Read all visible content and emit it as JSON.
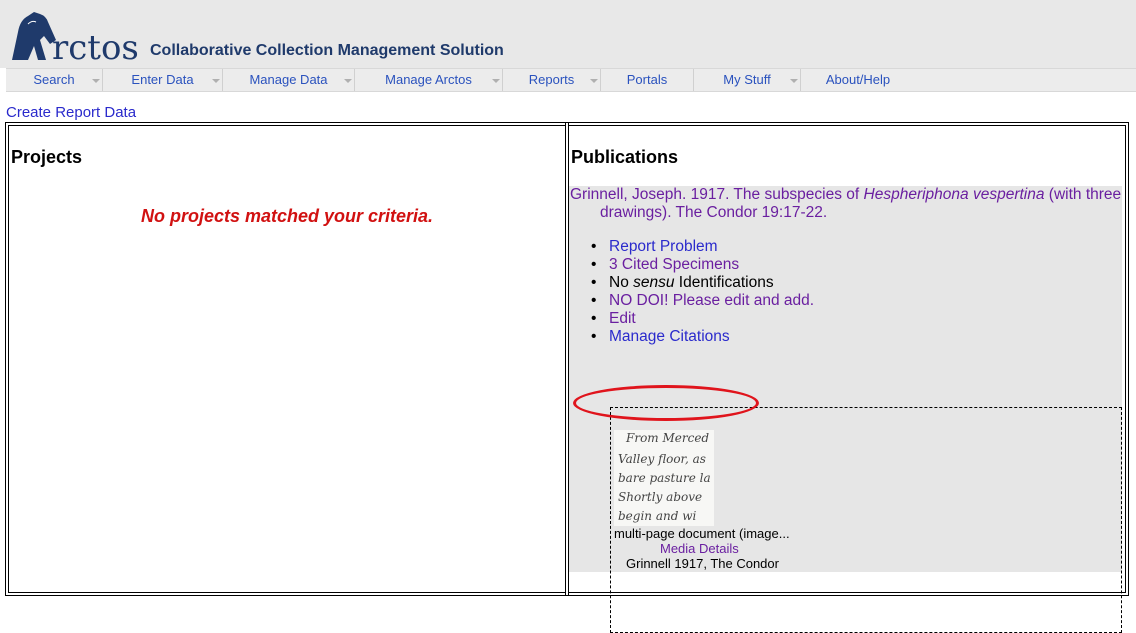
{
  "header": {
    "logo_text": "rctos",
    "tagline": "Collaborative Collection Management Solution"
  },
  "nav": {
    "items": [
      {
        "label": "Search"
      },
      {
        "label": "Enter Data"
      },
      {
        "label": "Manage Data"
      },
      {
        "label": "Manage Arctos"
      },
      {
        "label": "Reports"
      },
      {
        "label": "Portals"
      },
      {
        "label": "My Stuff"
      },
      {
        "label": "About/Help"
      }
    ]
  },
  "create_link": "Create Report Data",
  "projects": {
    "title": "Projects",
    "empty_message": "No projects matched your criteria."
  },
  "publications": {
    "title": "Publications",
    "citation_prefix": "Grinnell, Joseph. 1917. The subspecies of ",
    "citation_italic": "Hespheriphona vespertina",
    "citation_suffix": " (with three drawings). The Condor 19:17-22.",
    "actions": {
      "report_problem": "Report Problem",
      "cited_specimens": "3 Cited Specimens",
      "no_sensu_pre": "No ",
      "no_sensu_italic": "sensu",
      "no_sensu_post": " Identifications",
      "no_doi": "NO DOI! Please edit and add.",
      "edit": "Edit",
      "manage_citations": "Manage Citations"
    },
    "media": {
      "handwriting_lines": [
        "From Merced",
        "Valley floor, as",
        "bare pasture la",
        "Shortly above",
        "begin and wi"
      ],
      "caption": "multi-page document (image...",
      "details_link": "Media Details",
      "source": "Grinnell 1917, The Condor"
    }
  },
  "colors": {
    "link_blue": "#2a2acc",
    "link_visited": "#6a1fa0",
    "error_red": "#d11111",
    "highlight": "#e0141c",
    "brand": "#1f3a6b"
  }
}
